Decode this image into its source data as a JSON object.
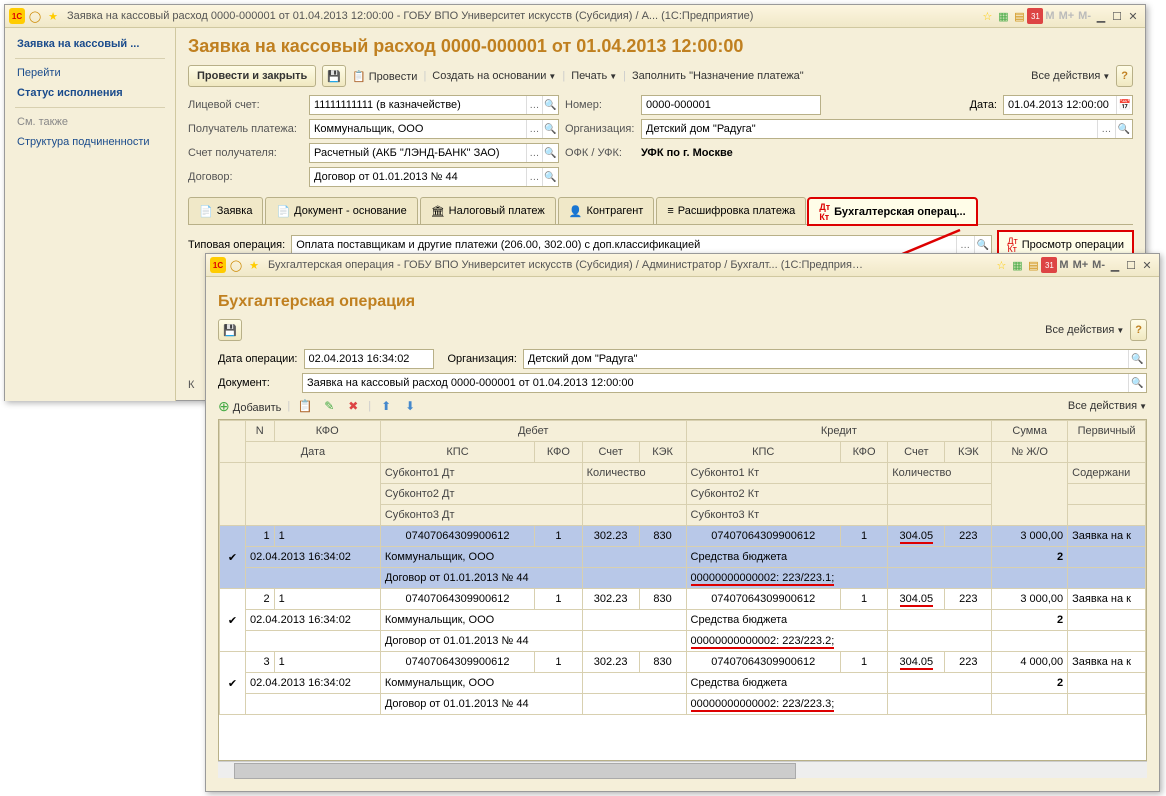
{
  "win1": {
    "title": "Заявка на кассовый расход 0000-000001 от 01.04.2013 12:00:00 - ГОБУ ВПО Университет искусств (Субсидия) / А...   (1С:Предприятие)",
    "mem": [
      "M",
      "M+",
      "M-"
    ]
  },
  "nav": {
    "items": [
      "Заявка на кассовый ...",
      "Перейти",
      "Статус исполнения"
    ],
    "see_also": "См. также",
    "sub": "Структура подчиненности"
  },
  "page": {
    "title": "Заявка на кассовый расход 0000-000001 от 01.04.2013 12:00:00",
    "btn_post_close": "Провести и закрыть",
    "btn_post": "Провести",
    "btn_basedon": "Создать на основании",
    "btn_print": "Печать",
    "btn_fill": "Заполнить \"Назначение платежа\"",
    "all_actions": "Все действия"
  },
  "form": {
    "account_lbl": "Лицевой счет:",
    "account_val": "11111111111 (в казначействе)",
    "number_lbl": "Номер:",
    "number_val": "0000-000001",
    "date_lbl": "Дата:",
    "date_val": "01.04.2013 12:00:00",
    "payee_lbl": "Получатель платежа:",
    "payee_val": "Коммунальщик, ООО",
    "org_lbl": "Организация:",
    "org_val": "Детский дом \"Радуга\"",
    "payeeacct_lbl": "Счет получателя:",
    "payeeacct_val": "Расчетный (АКБ \"ЛЭНД-БАНК\" ЗАО)",
    "ofk_lbl": "ОФК / УФК:",
    "ofk_val": "УФК по г. Москве",
    "contract_lbl": "Договор:",
    "contract_val": "Договор от 01.01.2013 № 44"
  },
  "tabs": [
    "Заявка",
    "Документ - основание",
    "Налоговый платеж",
    "Контрагент",
    "Расшифровка платежа",
    "Бухгалтерская операц..."
  ],
  "typ_op": {
    "lbl": "Типовая операция:",
    "val": "Оплата поставщикам и другие платежи (206.00, 302.00) с доп.классификацией",
    "view_btn": "Просмотр операции"
  },
  "win2": {
    "title": "Бухгалтерская операция - ГОБУ ВПО Университет искусств (Субсидия) / Администратор / Бухгалт...   (1С:Предприятие)",
    "mem": [
      "M",
      "M+",
      "M-"
    ]
  },
  "detail": {
    "title": "Бухгалтерская операция",
    "all_actions": "Все действия",
    "date_lbl": "Дата операции:",
    "date_val": "02.04.2013 16:34:02",
    "org_lbl": "Организация:",
    "org_val": "Детский дом \"Радуга\"",
    "doc_lbl": "Документ:",
    "doc_val": "Заявка на кассовый расход 0000-000001 от 01.04.2013 12:00:00",
    "add_btn": "Добавить"
  },
  "gridhead": {
    "n": "N",
    "kfo": "КФО",
    "debet": "Дебет",
    "credit": "Кредит",
    "sum": "Сумма",
    "prim": "Первичный",
    "date": "Дата",
    "kps": "КПС",
    "kfo2": "КФО",
    "acct": "Счет",
    "kek": "КЭК",
    "jo": "№ Ж/О",
    "sub1d": "Субконто1 Дт",
    "sub2d": "Субконто2 Дт",
    "sub3d": "Субконто3 Дт",
    "sub1k": "Субконто1 Кт",
    "sub2k": "Субконто2 Кт",
    "sub3k": "Субконто3 Кт",
    "qty": "Количество",
    "content": "Содержани"
  },
  "rows": [
    {
      "n": "1",
      "kfo": "1",
      "date": "02.04.2013 16:34:02",
      "kps_d": "07407064309900612",
      "kfo_d": "1",
      "acct_d": "302.23",
      "kek_d": "830",
      "sub1d": "Коммунальщик, ООО",
      "sub2d": "Договор от 01.01.2013 № 44",
      "kps_k": "07407064309900612",
      "kfo_k": "1",
      "acct_k": "304.05",
      "kek_k": "223",
      "sub1k": "Средства бюджета",
      "sub2k": "00000000000002: 223/223.1;",
      "sum": "3 000,00",
      "jo": "2",
      "desc": "Заявка на к"
    },
    {
      "n": "2",
      "kfo": "1",
      "date": "02.04.2013 16:34:02",
      "kps_d": "07407064309900612",
      "kfo_d": "1",
      "acct_d": "302.23",
      "kek_d": "830",
      "sub1d": "Коммунальщик, ООО",
      "sub2d": "Договор от 01.01.2013 № 44",
      "kps_k": "07407064309900612",
      "kfo_k": "1",
      "acct_k": "304.05",
      "kek_k": "223",
      "sub1k": "Средства бюджета",
      "sub2k": "00000000000002: 223/223.2;",
      "sum": "3 000,00",
      "jo": "2",
      "desc": "Заявка на к"
    },
    {
      "n": "3",
      "kfo": "1",
      "date": "02.04.2013 16:34:02",
      "kps_d": "07407064309900612",
      "kfo_d": "1",
      "acct_d": "302.23",
      "kek_d": "830",
      "sub1d": "Коммунальщик, ООО",
      "sub2d": "Договор от 01.01.2013 № 44",
      "kps_k": "07407064309900612",
      "kfo_k": "1",
      "acct_k": "304.05",
      "kek_k": "223",
      "sub1k": "Средства бюджета",
      "sub2k": "00000000000002: 223/223.3;",
      "sum": "4 000,00",
      "jo": "2",
      "desc": "Заявка на к"
    }
  ],
  "trunc": "К"
}
